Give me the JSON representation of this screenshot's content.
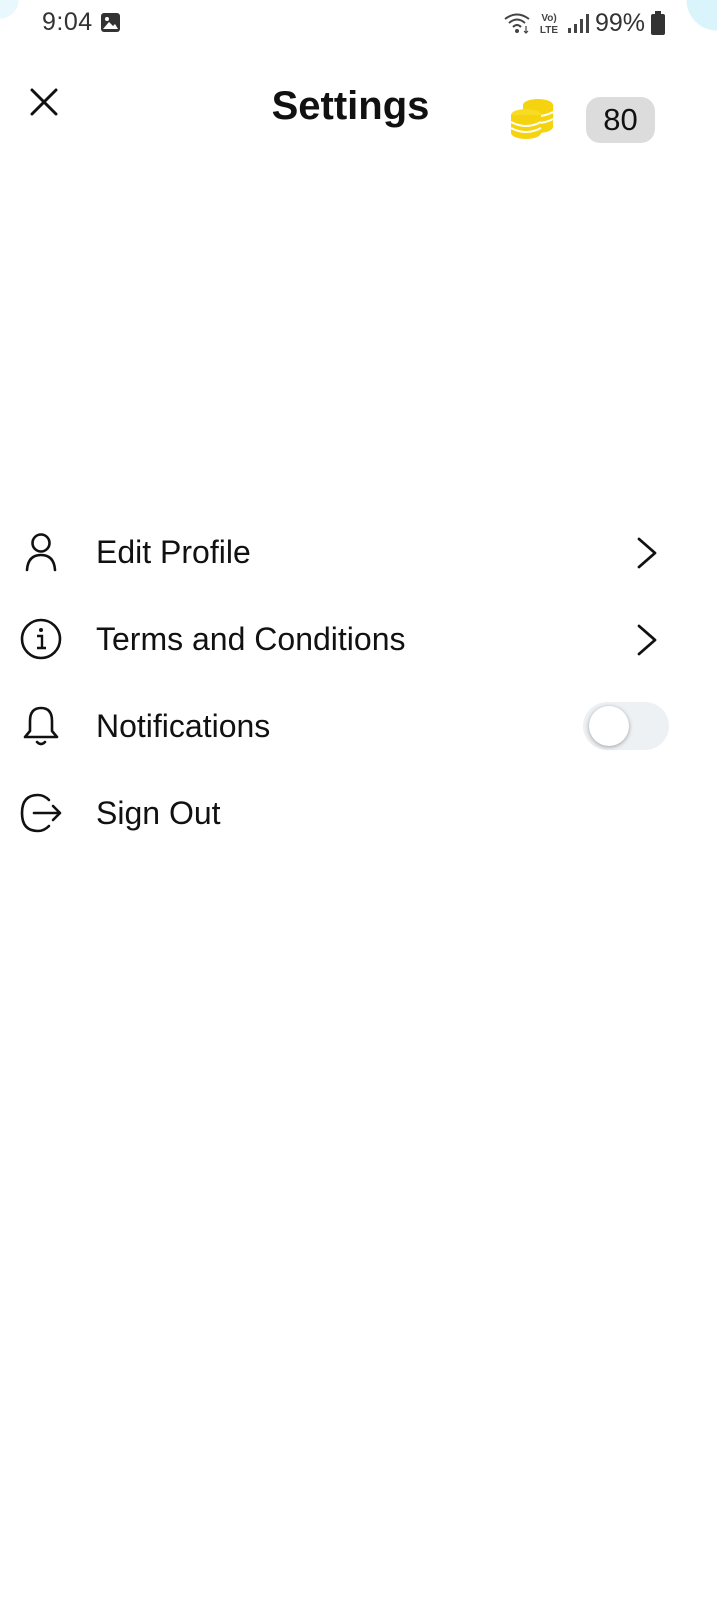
{
  "status_bar": {
    "time": "9:04",
    "network_label": "Vo) LTE",
    "battery": "99%",
    "icons": [
      "gallery-icon",
      "wifi-icon",
      "volte-icon",
      "signal-icon",
      "battery-icon"
    ]
  },
  "header": {
    "title": "Settings",
    "coin_count": "80",
    "close_icon": "close-icon",
    "coins_icon": "coins-icon"
  },
  "menu": {
    "items": [
      {
        "label": "Edit Profile",
        "icon": "user-icon",
        "trailing": "chevron"
      },
      {
        "label": "Terms and Conditions",
        "icon": "info-icon",
        "trailing": "chevron"
      },
      {
        "label": "Notifications",
        "icon": "bell-icon",
        "trailing": "toggle",
        "toggle_on": false
      },
      {
        "label": "Sign Out",
        "icon": "sign-out-icon",
        "trailing": "none"
      }
    ]
  },
  "colors": {
    "coin": "#f5d40f",
    "coin_badge_bg": "#dcdcdc",
    "toggle_track": "#eef1f4"
  }
}
